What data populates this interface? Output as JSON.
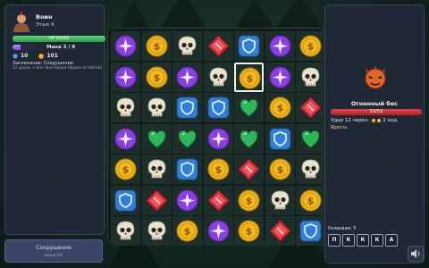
{
  "hero": {
    "name": "Воин",
    "floor": "Этаж 6",
    "hp_text": "HP 65/65",
    "hp_fraction": 1.0,
    "mana_text": "Мана 3 / 9",
    "mana_fraction": 0.333,
    "armor": "10",
    "gold": "101",
    "spell_title": "Заклинание: Сокрушение",
    "spell_desc": "12 урона + все твоя броня (броня остаётся)"
  },
  "skill_button": {
    "name": "Сокрушение",
    "cost": "мана 3/9"
  },
  "enemy": {
    "name": "Огненный бес",
    "hp_text": "53/53",
    "hp_fraction": 1.0,
    "attack_text": "Удар 12 через:",
    "attack_suffix": "2 ход.",
    "rage": "Ярость"
  },
  "relics": {
    "label": "Реликвии: 5",
    "keys": [
      "П",
      "К",
      "К",
      "К",
      "А"
    ]
  },
  "board": {
    "rows": [
      [
        "star",
        "coin",
        "skull",
        "ruby",
        "shield",
        "star",
        "coin"
      ],
      [
        "star",
        "coin",
        "star",
        "skull",
        "coin",
        "star",
        "skull"
      ],
      [
        "skull",
        "skull",
        "shield",
        "shield",
        "emerald",
        "coin",
        "ruby"
      ],
      [
        "star",
        "emerald",
        "emerald",
        "star",
        "emerald",
        "shield",
        "emerald"
      ],
      [
        "coin",
        "skull",
        "shield",
        "coin",
        "ruby",
        "coin",
        "skull"
      ],
      [
        "shield",
        "ruby",
        "star",
        "ruby",
        "coin",
        "skull",
        "coin"
      ],
      [
        "skull",
        "skull",
        "coin",
        "star",
        "coin",
        "ruby",
        "shield"
      ]
    ],
    "selected": [
      1,
      4
    ]
  },
  "colors": {
    "hp": "#3fbf5c",
    "mana": "#9a72ee",
    "enemy_hp": "#d23236",
    "gold": "#f2b81e",
    "star": "#8a3fe0",
    "shield": "#2f7fd8",
    "ruby": "#d6303c",
    "emerald": "#2fb65a",
    "skull": "#e8e2cf"
  },
  "icons": {
    "hero": "warrior-portrait",
    "enemy": "fire-imp-portrait",
    "armor": "shield-icon",
    "gold": "coin-icon",
    "sound": "speaker-icon"
  }
}
